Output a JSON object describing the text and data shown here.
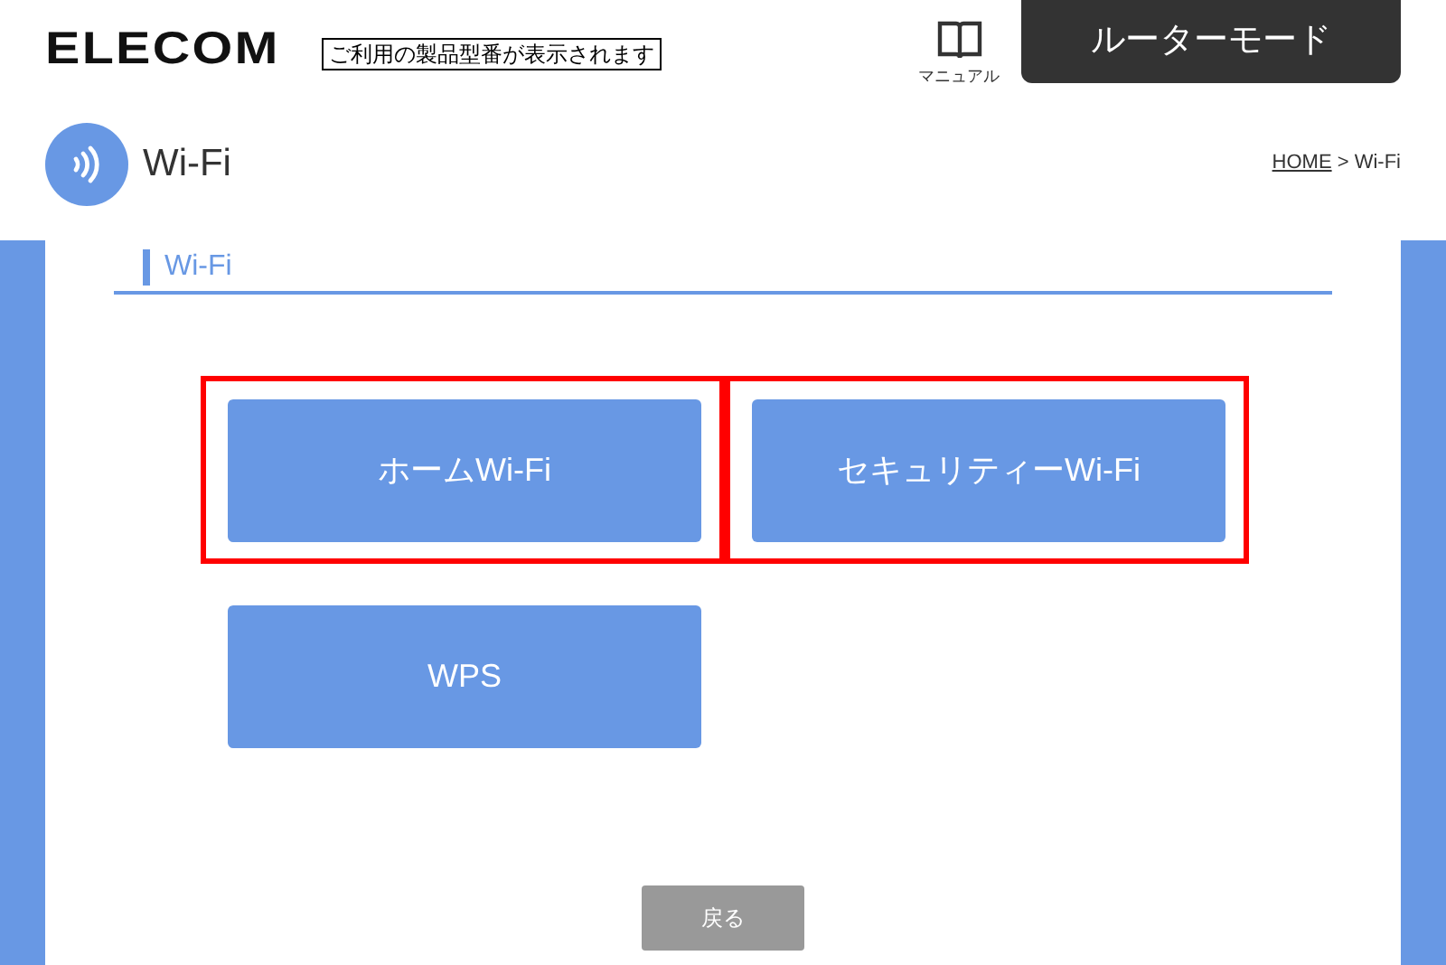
{
  "header": {
    "logo": "ELECOM",
    "model_notice": "ご利用の製品型番が表示されます",
    "manual_label": "マニュアル",
    "mode_button": "ルーターモード"
  },
  "page": {
    "title": "Wi-Fi",
    "breadcrumb": [
      {
        "label": "HOME",
        "link": true
      },
      {
        "label": " > Wi-Fi",
        "link": false
      }
    ]
  },
  "section": {
    "heading": "Wi-Fi"
  },
  "buttons": [
    {
      "label": "ホームWi-Fi",
      "highlighted": true
    },
    {
      "label": "セキュリティーWi-Fi",
      "highlighted": true
    },
    {
      "label": "WPS",
      "highlighted": false
    }
  ],
  "back_button": "戻る"
}
